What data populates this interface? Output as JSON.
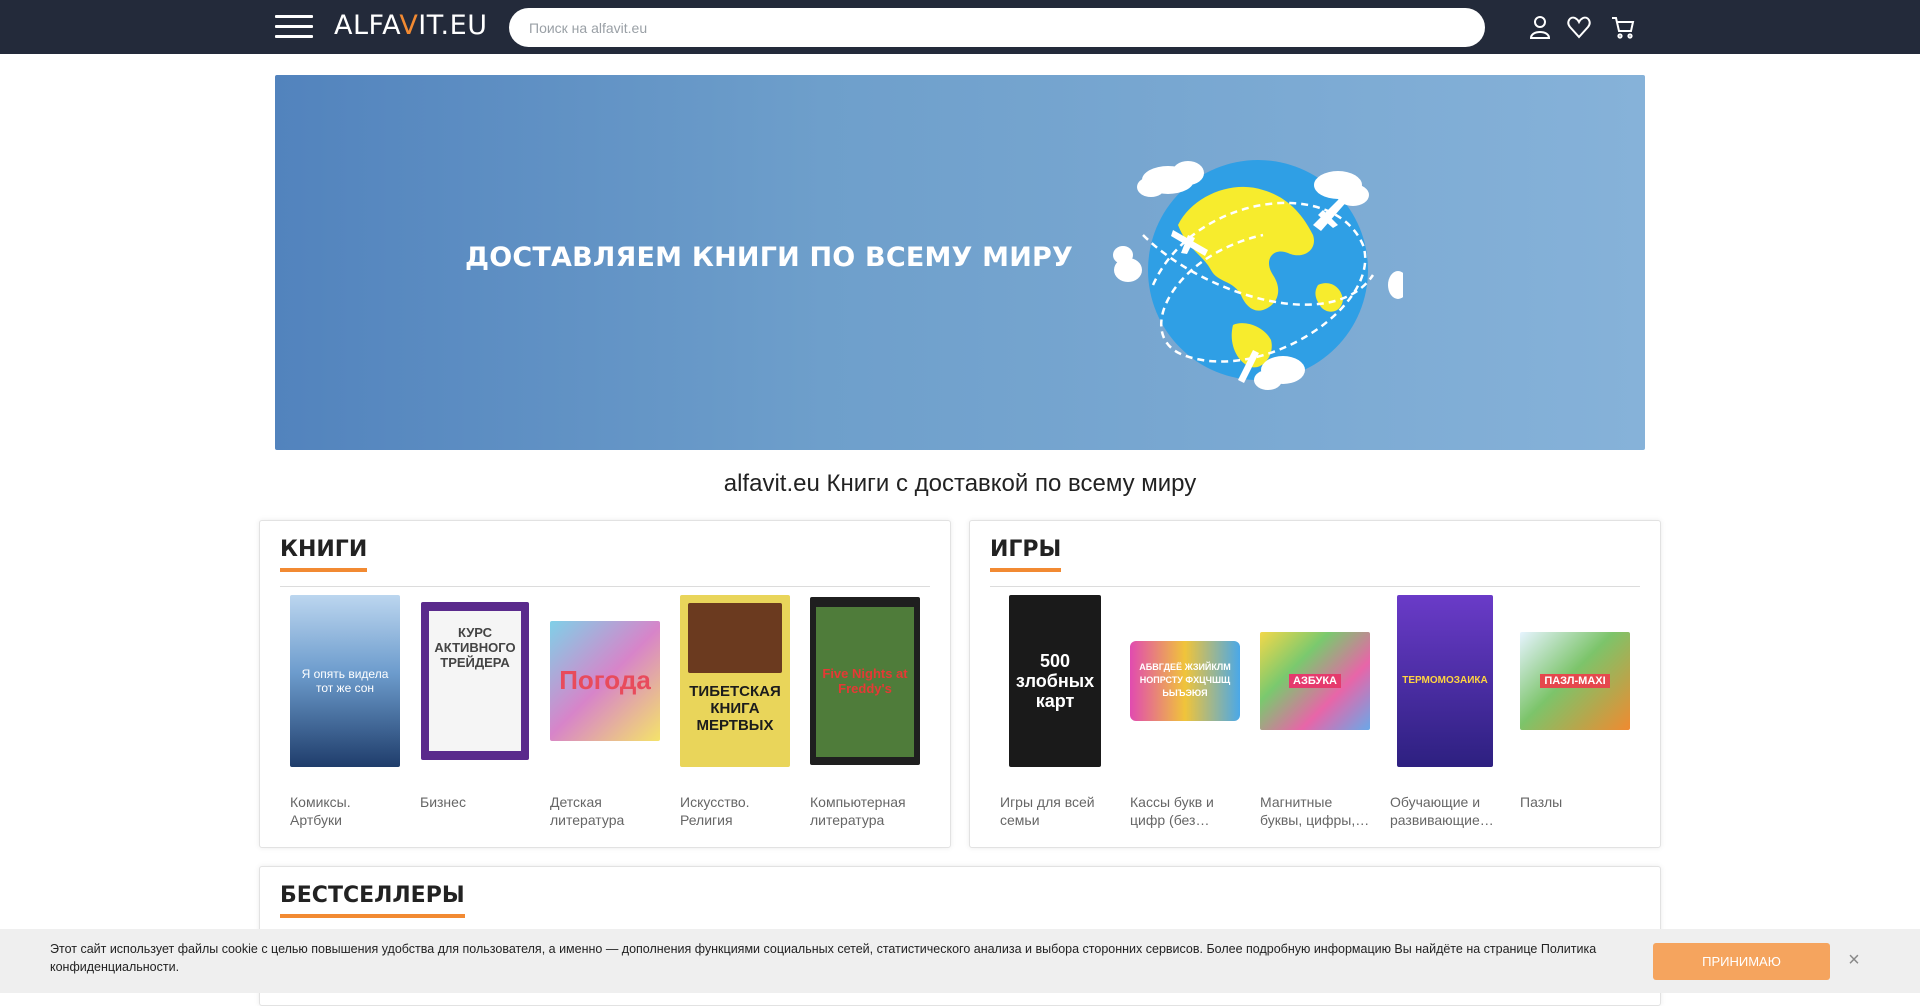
{
  "header": {
    "logo_prefix": "ALFA",
    "logo_v": "V",
    "logo_suffix": "IT.EU",
    "search_placeholder": "Поиск на alfavit.eu",
    "icons": [
      "menu-icon",
      "user-icon",
      "heart-icon",
      "cart-icon"
    ]
  },
  "banner": {
    "text": "ДОСТАВЛЯЕМ КНИГИ ПО ВСЕМУ МИРУ"
  },
  "page_title": "alfavit.eu Книги с доставкой по всему миру",
  "books": {
    "title": "КНИГИ",
    "items": [
      {
        "label": "Комиксы. Артбуки",
        "cover_text": "Я опять видела тот же сон"
      },
      {
        "label": "Бизнес",
        "cover_text": "КУРС АКТИВНОГО ТРЕЙДЕРА"
      },
      {
        "label": "Детская литература",
        "cover_text": "Погода"
      },
      {
        "label": "Искусство. Религия",
        "cover_text": "ТИБЕТСКАЯ КНИГА МЕРТВЫХ"
      },
      {
        "label": "Компьютерная литература",
        "cover_text": "Five Nights at Freddy's"
      }
    ]
  },
  "games": {
    "title": "ИГРЫ",
    "items": [
      {
        "label": "Игры для всей семьи",
        "cover_text": "500 злобных карт"
      },
      {
        "label": "Кассы букв и цифр (без…",
        "cover_text": "АБВГДЕЁ ЖЗИЙКЛМ НОПРСТУ ФХЦЧШЩ ЬЫЪЭЮЯ"
      },
      {
        "label": "Магнитные буквы, цифры,…",
        "cover_text": "АЗБУКА"
      },
      {
        "label": "Обучающие и развивающие…",
        "cover_text": "ТЕРМОМОЗАИКА"
      },
      {
        "label": "Пазлы",
        "cover_text": "ПАЗЛ-MAXI"
      }
    ]
  },
  "bestsellers": {
    "title": "БЕСТСЕЛЛЕРЫ"
  },
  "cookie": {
    "text": "Этот сайт использует файлы cookie с целью повышения удобства для пользователя, а именно — дополнения функциями социальных сетей, статистического анализа и выбора сторонних сервисов. Более подробную информацию Вы найдёте на странице Политика конфиденциальности.",
    "accept_label": "ПРИНИМАЮ",
    "close_label": "×"
  },
  "colors": {
    "header_bg": "#232a3a",
    "accent": "#f28a32",
    "cookie_button": "#f5a45e"
  }
}
